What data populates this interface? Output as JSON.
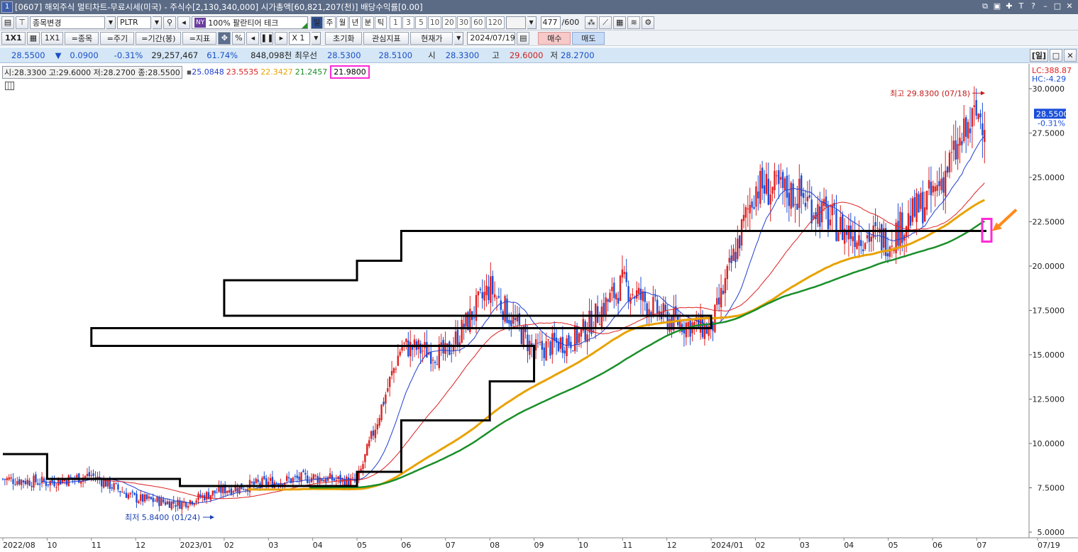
{
  "window": {
    "number": "1",
    "title": "[0607] 해외주식 멀티차트-무료시세(미국) - 주식수[2,130,340,000] 시가총액[60,821,207(천)] 배당수익률[0.00]",
    "icons": [
      "minimize-to-tray-icon",
      "restore-icon",
      "pin-icon",
      "font-icon",
      "help-icon",
      "minimize-icon",
      "maximize-icon",
      "close-icon"
    ],
    "glyphs": [
      "⧉",
      "▣",
      "✚",
      "T",
      "?",
      "–",
      "□",
      "✕"
    ]
  },
  "toolbar1": {
    "stock_change": "종목변경",
    "symbol": "PLTR",
    "market_flag": "NY",
    "zoom_name": "100% 팔란티어 테크",
    "periods": [
      "일",
      "주",
      "월",
      "년",
      "분",
      "틱"
    ],
    "period_active": "일",
    "intervals": [
      "1",
      "3",
      "5",
      "10",
      "20",
      "30",
      "60",
      "120"
    ],
    "count": "477",
    "count_total": "/600"
  },
  "toolbar2": {
    "layout1": "1X1",
    "layout2": "1X1",
    "items": "=종목",
    "cycle": "=주기",
    "period": "=기간(봉)",
    "indicator": "=지표",
    "percent": "%",
    "multiplier": "X 1",
    "reset": "초기화",
    "watch_indicator": "관심지표",
    "price_type": "현재가",
    "date": "2024/07/19",
    "buy": "매수",
    "sell": "매도"
  },
  "quote": {
    "price": "28.5500",
    "arrow": "▼",
    "change": "0.0900",
    "change_pct": "-0.31%",
    "volume": "29,257,467",
    "vol_ratio": "61.74%",
    "amount": "848,098천",
    "best_label": "최우선",
    "best_ask": "28.5300",
    "best_bid": "28.5100",
    "open_label": "시",
    "open": "28.3300",
    "high_label": "고",
    "high": "29.6000",
    "low_label": "저",
    "low": "28.2700",
    "period_badge": "[일]"
  },
  "legend": {
    "ohlc": "시:28.3300 고:29.6000 저:28.2700 종:28.5500",
    "ma1": "25.0848",
    "ma2": "23.5535",
    "ma3": "22.3427",
    "ma4": "21.2457",
    "highlight": "21.9800",
    "colors": {
      "ma1": "#1f3fcf",
      "ma2": "#d22",
      "ma3": "#e8a200",
      "ma4": "#1a8f2a",
      "step": "#000000"
    }
  },
  "axis_info": {
    "lc": "LC:388.87",
    "hc": "HC:-4.29",
    "last": "28.5500",
    "last_pct": "-0.31%"
  },
  "annotations": {
    "high": "최고 29.8300 (07/18)",
    "low": "최저 5.8400 (01/24)"
  },
  "chart_data": {
    "type": "candlestick",
    "y_ticks": [
      "30.0000",
      "27.5000",
      "25.0000",
      "22.5000",
      "20.0000",
      "17.5000",
      "15.0000",
      "12.5000",
      "10.0000",
      "7.5000",
      "5.0000"
    ],
    "ylim": [
      5.0,
      30.0
    ],
    "x_ticks": [
      "2022/08",
      "10",
      "11",
      "12",
      "2023/01",
      "02",
      "03",
      "04",
      "05",
      "06",
      "07",
      "08",
      "09",
      "10",
      "11",
      "12",
      "2024/01",
      "02",
      "03",
      "04",
      "05",
      "06",
      "07",
      "07/19"
    ],
    "close_anchors": [
      [
        "2022/08",
        8.0
      ],
      [
        "10",
        7.8
      ],
      [
        "11",
        8.2
      ],
      [
        "12",
        6.9
      ],
      [
        "2023/01",
        6.6
      ],
      [
        "02",
        7.4
      ],
      [
        "03",
        7.8
      ],
      [
        "04",
        8.1
      ],
      [
        "05",
        7.8
      ],
      [
        "06",
        15.5
      ],
      [
        "07",
        15.0
      ],
      [
        "08",
        18.8
      ],
      [
        "09",
        15.2
      ],
      [
        "10",
        16.0
      ],
      [
        "11",
        19.0
      ],
      [
        "12",
        17.0
      ],
      [
        "2024/01",
        16.4
      ],
      [
        "02",
        24.5
      ],
      [
        "03",
        24.0
      ],
      [
        "04",
        22.0
      ],
      [
        "05",
        21.5
      ],
      [
        "06",
        24.0
      ],
      [
        "07",
        28.55
      ]
    ],
    "step_line": [
      [
        "2022/08",
        9.4
      ],
      [
        "10",
        8.0
      ],
      [
        "2023/01",
        7.6
      ],
      [
        "05",
        8.4
      ],
      [
        "06",
        11.3
      ],
      [
        "08",
        13.5
      ],
      [
        "09",
        15.5
      ],
      [
        "11",
        16.5
      ],
      [
        "2024/01",
        17.2
      ],
      [
        "02",
        19.2
      ],
      [
        "05",
        20.3
      ],
      [
        "06",
        21.98
      ]
    ],
    "high": 29.83,
    "low": 5.84
  }
}
